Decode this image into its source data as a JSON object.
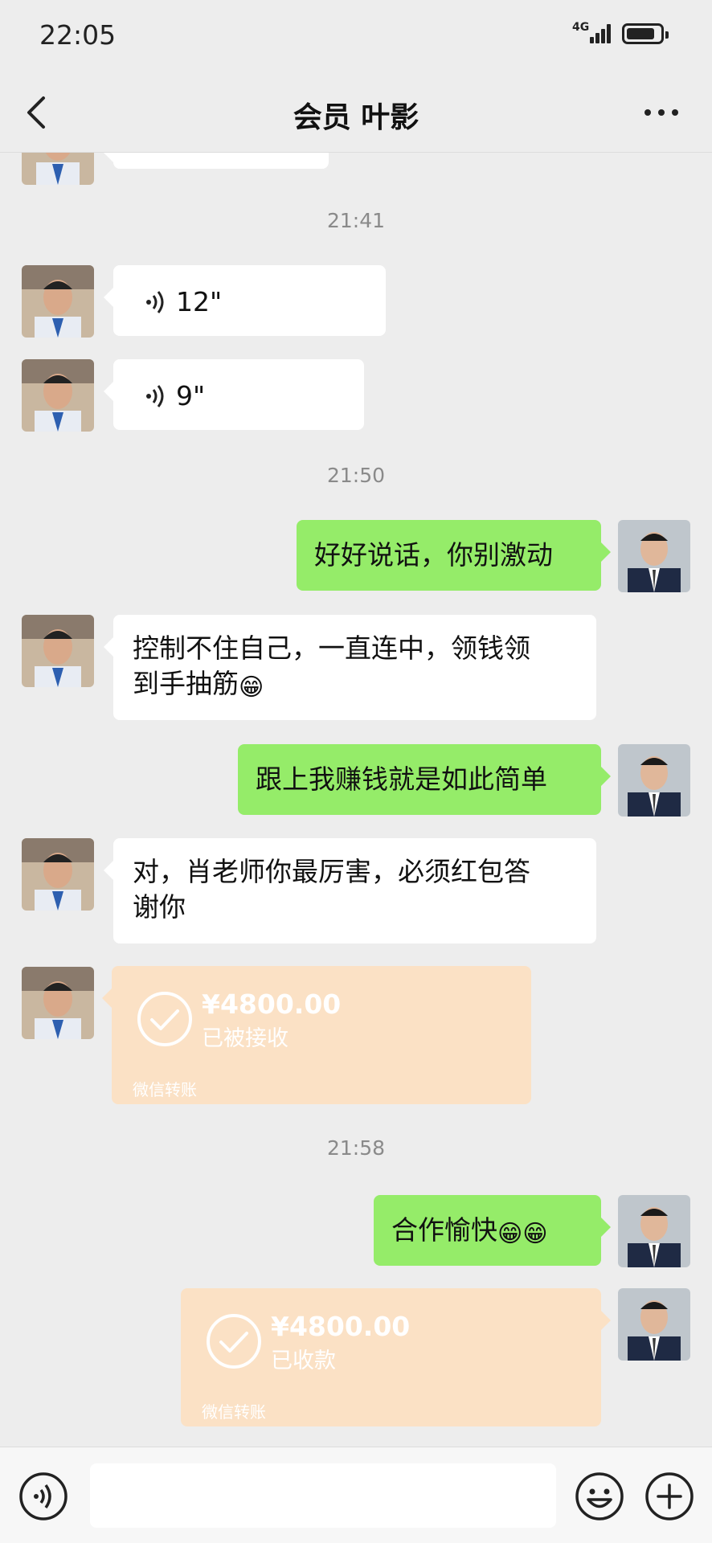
{
  "status_bar": {
    "time": "22:05",
    "network": "4G"
  },
  "nav": {
    "title": "会员 叶影"
  },
  "messages": {
    "ts1": "21:41",
    "voice1": "12\"",
    "voice2": "9\"",
    "ts2": "21:50",
    "msg1": "好好说话，你别激动",
    "msg2_line1": "控制不住自己，一直连中，领钱领",
    "msg2_line2": "到手抽筋",
    "msg3": "跟上我赚钱就是如此简单",
    "msg4_line1": "对，肖老师你最厉害，必须红包答",
    "msg4_line2": "谢你",
    "transfer1": {
      "amount": "¥4800.00",
      "status": "已被接收",
      "label": "微信转账"
    },
    "ts3": "21:58",
    "msg5": "合作愉快",
    "transfer2": {
      "amount": "¥4800.00",
      "status": "已收款",
      "label": "微信转账"
    },
    "grin_emoji": "😁"
  },
  "icons": {
    "back": "chevron-left-icon",
    "more": "more-dots-icon",
    "voice": "voice-input-icon",
    "emoji": "emoji-icon",
    "plus": "plus-icon"
  },
  "colors": {
    "background": "#ededed",
    "sent_bubble": "#95ec69",
    "received_bubble": "#ffffff",
    "transfer_card": "#fbe1c5"
  }
}
